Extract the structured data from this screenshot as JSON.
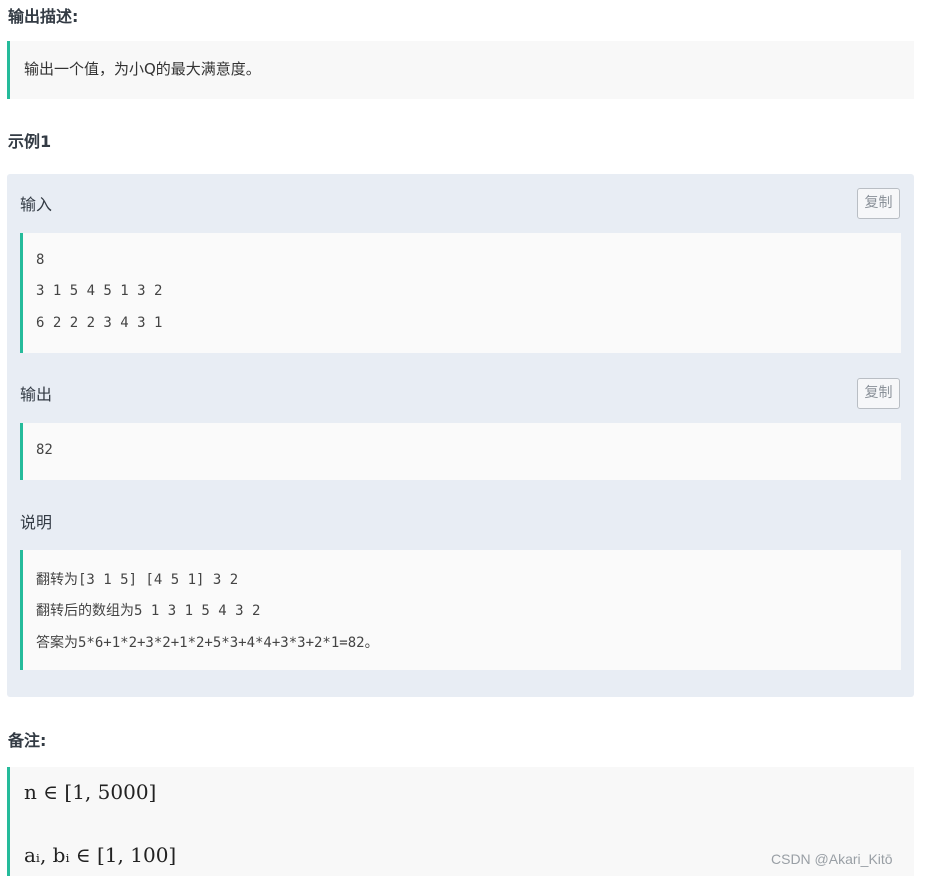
{
  "output_description": {
    "heading": "输出描述:",
    "text": "输出一个值，为小Q的最大满意度。"
  },
  "example": {
    "heading": "示例1",
    "input": {
      "label": "输入",
      "copy_label": "复制",
      "lines": [
        "8",
        "3 1 5 4 5 1 3 2",
        "6 2 2 2 3 4 3 1"
      ]
    },
    "output": {
      "label": "输出",
      "copy_label": "复制",
      "lines": [
        "82"
      ]
    },
    "explanation": {
      "label": "说明",
      "lines": [
        "翻转为[3 1 5] [4 5 1] 3 2",
        "翻转后的数组为5 1 3 1 5 4 3 2",
        "答案为5*6+1*2+3*2+1*2+5*3+4*4+3*3+2*1=82。"
      ]
    }
  },
  "notes": {
    "heading": "备注:",
    "constraints": [
      "n ∈ [1, 5000]",
      "aᵢ, bᵢ ∈ [1, 100]"
    ]
  },
  "watermark": "CSDN @Akari_Kitō",
  "colors": {
    "accent": "#25bb9b",
    "panel_bg": "#e8edf4",
    "code_bg": "#fafafa"
  }
}
